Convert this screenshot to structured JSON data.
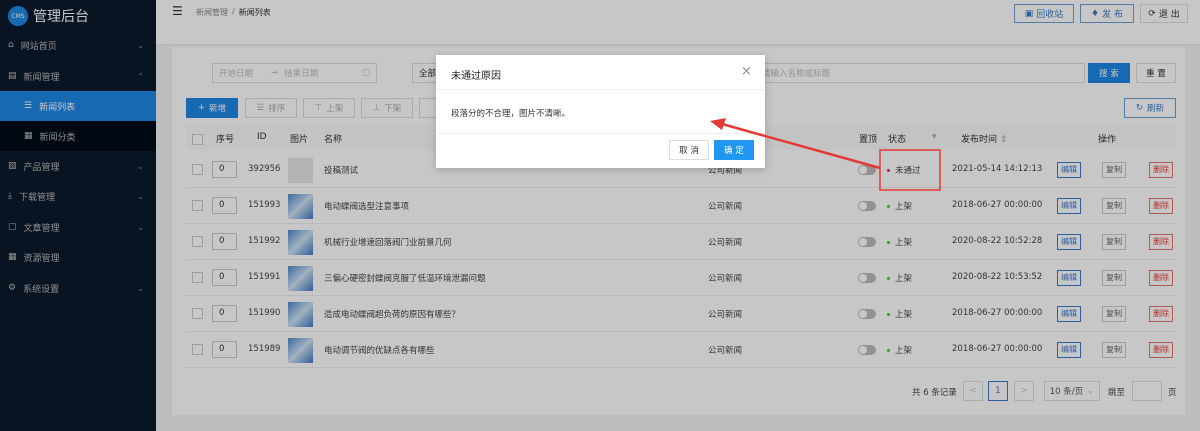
{
  "app": {
    "logo_badge": "CMS",
    "title": "管理后台"
  },
  "sidebar": {
    "items": [
      {
        "label": "网站首页",
        "icon": "home-icon",
        "chev": "⌄"
      },
      {
        "label": "新闻管理",
        "icon": "news-icon",
        "chev": "⌃"
      },
      {
        "label": "新闻列表",
        "icon": "list-icon"
      },
      {
        "label": "新闻分类",
        "icon": "grid-icon"
      },
      {
        "label": "产品管理",
        "icon": "product-icon",
        "chev": "⌄"
      },
      {
        "label": "下载管理",
        "icon": "download-icon",
        "chev": "⌄"
      },
      {
        "label": "文章管理",
        "icon": "article-icon",
        "chev": "⌄"
      },
      {
        "label": "资源管理",
        "icon": "resource-icon"
      },
      {
        "label": "系统设置",
        "icon": "gear-icon",
        "chev": "⌄"
      }
    ]
  },
  "header": {
    "breadcrumb": [
      "新闻管理",
      "新闻列表"
    ],
    "separator": "/",
    "recycle": "回收站",
    "publish": "发 布",
    "logout": "退 出"
  },
  "filters": {
    "start_date": "开始日期",
    "arrow": "→",
    "end_date": "结束日期",
    "category": "全部",
    "search_placeholder": "请输入名称或标题",
    "search": "搜 索",
    "reset": "重 置"
  },
  "toolbar": {
    "add": "新增",
    "sort": "排序",
    "on_shelf": "上架",
    "off_shelf": "下架",
    "refresh": "刷新"
  },
  "table": {
    "headers": {
      "sort": "序号",
      "id": "ID",
      "image": "图片",
      "name": "名称",
      "top": "置顶",
      "status": "状态",
      "time": "发布时间",
      "ops": "操作"
    },
    "rows": [
      {
        "sort": "0",
        "id": "392956",
        "name": "投稿测试",
        "category": "公司新闻",
        "status": "未通过",
        "status_color": "#d9363e",
        "time": "2021-05-14 14:12:13",
        "placeholder_img": true
      },
      {
        "sort": "0",
        "id": "151993",
        "name": "电动蝶阀选型注意事项",
        "category": "公司新闻",
        "status": "上架",
        "status_color": "#52c41a",
        "time": "2018-06-27 00:00:00"
      },
      {
        "sort": "0",
        "id": "151992",
        "name": "机械行业增速回落阀门业前景几何",
        "category": "公司新闻",
        "status": "上架",
        "status_color": "#52c41a",
        "time": "2020-08-22 10:52:28"
      },
      {
        "sort": "0",
        "id": "151991",
        "name": "三偏心硬密封蝶阀克服了低温环境泄漏问题",
        "category": "公司新闻",
        "status": "上架",
        "status_color": "#52c41a",
        "time": "2020-08-22 10:53:52"
      },
      {
        "sort": "0",
        "id": "151990",
        "name": "造成电动蝶阀超负荷的原因有哪些？",
        "category": "公司新闻",
        "status": "上架",
        "status_color": "#52c41a",
        "time": "2018-06-27 00:00:00"
      },
      {
        "sort": "0",
        "id": "151989",
        "name": "电动调节阀的优缺点各有哪些",
        "category": "公司新闻",
        "status": "上架",
        "status_color": "#52c41a",
        "time": "2018-06-27 00:00:00"
      }
    ],
    "ops": {
      "edit": "编辑",
      "copy": "复制",
      "delete": "删除"
    }
  },
  "pagination": {
    "total": "共 6 条记录",
    "prev": "<",
    "page": "1",
    "next": ">",
    "page_size": "10 条/页",
    "goto": "跳至",
    "page_unit": "页"
  },
  "modal": {
    "title": "未通过原因",
    "close": "×",
    "body": "段落分的不合理，图片不清晰。",
    "cancel": "取 消",
    "ok": "确 定"
  },
  "colors": {
    "primary": "#1e88e5",
    "sidebar": "#0c1a2c",
    "annotation": "#e53935"
  }
}
